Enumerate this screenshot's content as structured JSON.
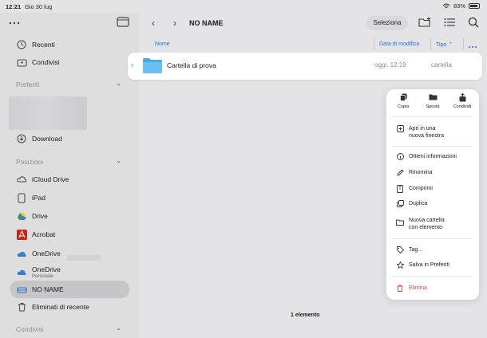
{
  "status": {
    "time": "12:21",
    "date": "Gio 30 lug",
    "battery": "83%"
  },
  "sidebar": {
    "top_items": [
      {
        "label": "Recenti",
        "icon": "clock-icon"
      },
      {
        "label": "Condivisi",
        "icon": "shared-folder-icon"
      }
    ],
    "preferiti_header": "Preferiti",
    "download_label": "Download",
    "posizioni_header": "Posizioni",
    "locations": [
      {
        "label": "iCloud Drive",
        "sub": ""
      },
      {
        "label": "iPad",
        "sub": ""
      },
      {
        "label": "Drive",
        "sub": ""
      },
      {
        "label": "Acrobat",
        "sub": ""
      },
      {
        "label": "OneDrive",
        "sub": ""
      },
      {
        "label": "OneDrive",
        "sub": "Personale"
      },
      {
        "label": "NO NAME",
        "sub": ""
      },
      {
        "label": "Eliminati di recente",
        "sub": ""
      }
    ],
    "condivisi_header": "Condivisi"
  },
  "toolbar": {
    "title": "NO NAME",
    "select_label": "Seleziona"
  },
  "columns": {
    "name": "Nome",
    "date": "Data di modifica",
    "kind": "Tipo"
  },
  "file_row": {
    "name": "Cartella di prova",
    "date": "oggi, 12:19",
    "kind": "cartella"
  },
  "footer": {
    "count": "1 elemento"
  },
  "menu": {
    "top": [
      {
        "label": "Copia",
        "icon": "copy-icon"
      },
      {
        "label": "Sposta",
        "icon": "move-folder-icon"
      },
      {
        "label": "Condividi",
        "icon": "share-icon"
      }
    ],
    "open_window_line1": "Apri in una",
    "open_window_line2": "nuova finestra",
    "info": "Ottieni informazioni",
    "rename": "Rinomina",
    "compress": "Comprimi",
    "duplicate": "Duplica",
    "new_folder_line1": "Nuova cartella",
    "new_folder_line2": "con elemento",
    "tag": "Tag...",
    "save_fav": "Salva in Preferiti",
    "delete": "Elimina"
  },
  "colors": {
    "accent": "#2a6fd6",
    "danger": "#e0403a",
    "folder": "#5bb3e8"
  }
}
